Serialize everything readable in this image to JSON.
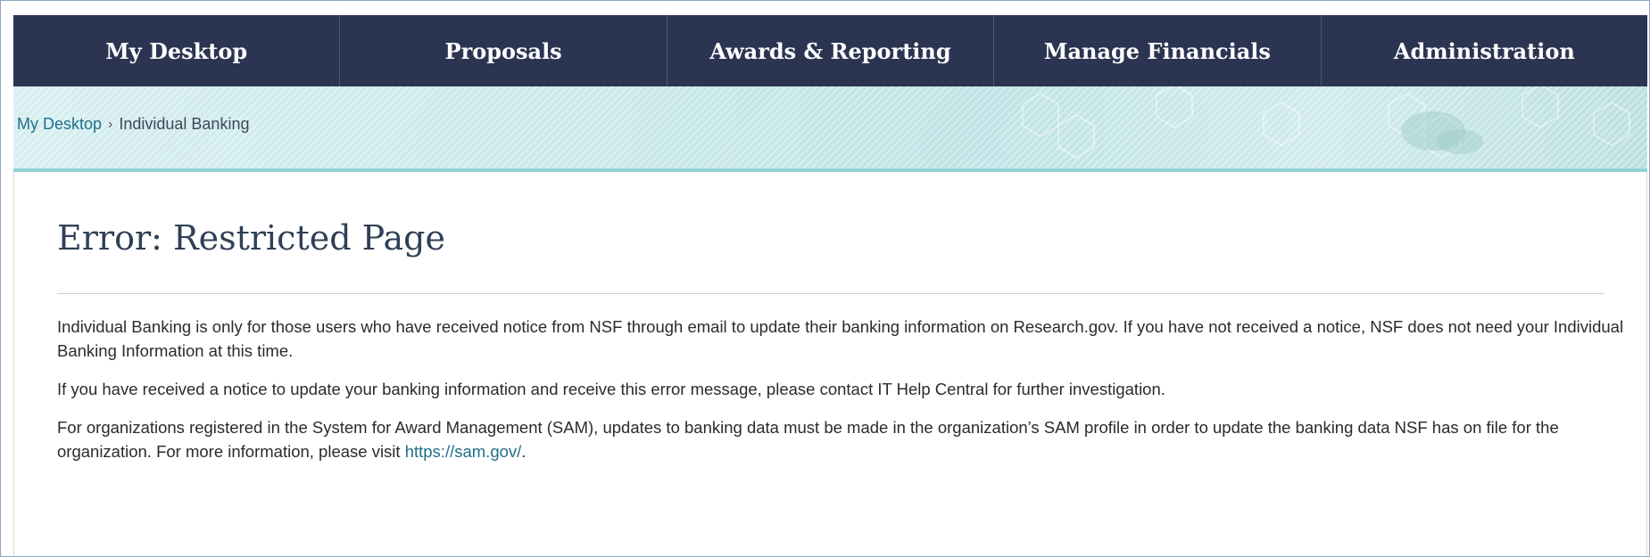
{
  "nav": {
    "items": [
      {
        "label": "My Desktop"
      },
      {
        "label": "Proposals"
      },
      {
        "label": "Awards & Reporting"
      },
      {
        "label": "Manage Financials"
      },
      {
        "label": "Administration"
      }
    ]
  },
  "breadcrumb": {
    "home": "My Desktop",
    "separator": "›",
    "current": "Individual Banking"
  },
  "page": {
    "title": "Error: Restricted Page",
    "paragraph1": "Individual Banking is only for those users who have received notice from NSF through email to update their banking information on Research.gov. If you have not received a notice, NSF does not need your Individual Banking Information at this time.",
    "paragraph2": "If you have received a notice to update your banking information and receive this error message, please contact IT Help Central for further investigation.",
    "paragraph3_before": "For organizations registered in the System for Award Management (SAM), updates to banking data must be made in the organization’s SAM profile in order to update the banking data NSF has on file for the organization. For more information, please visit ",
    "paragraph3_link": "https://sam.gov/",
    "paragraph3_after": "."
  },
  "colors": {
    "nav_background": "#2b3552",
    "hero_accent": "#8fd3d2",
    "link": "#1f6f8b",
    "title": "#2f3f56"
  }
}
